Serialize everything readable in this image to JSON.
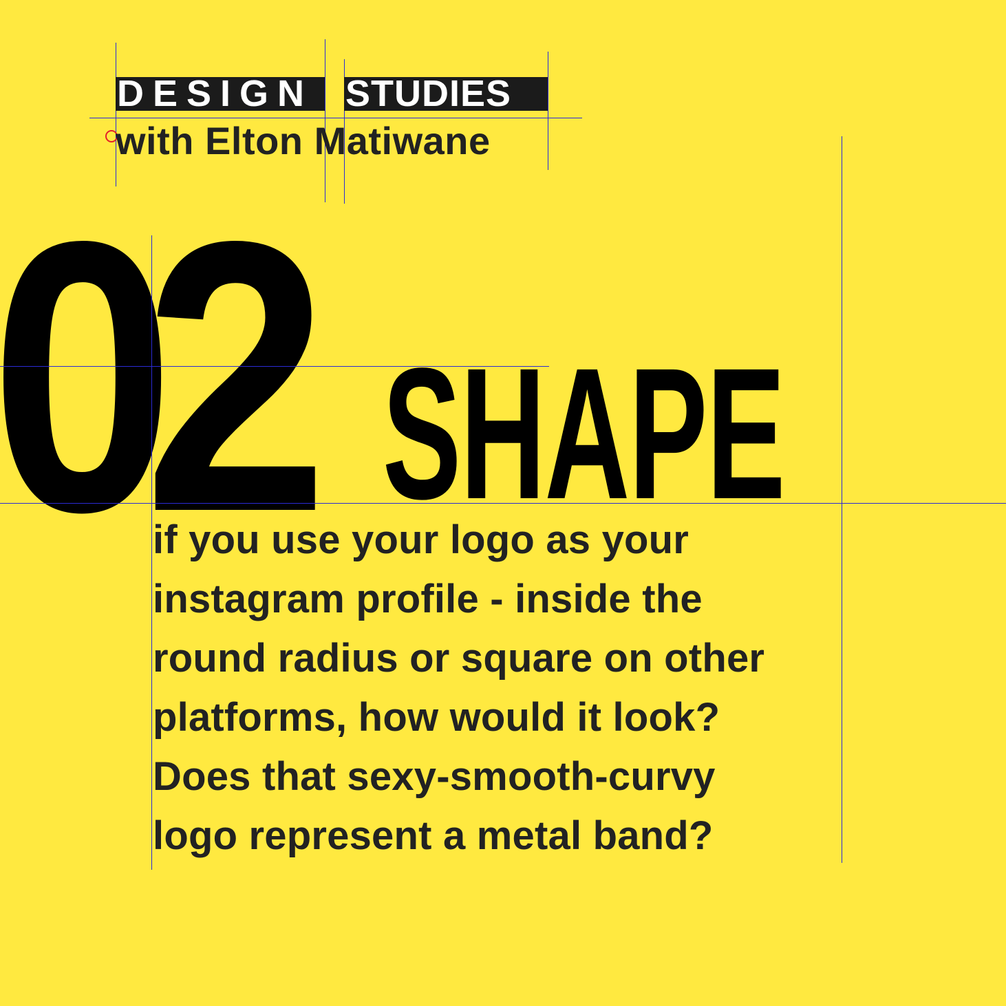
{
  "colors": {
    "background": "#FFE940",
    "title_bar": "#1B1B1B",
    "text_dark": "#222222",
    "display_black": "#000000",
    "guide_blue": "#2B2BD6",
    "anchor_red": "#E4202A"
  },
  "header": {
    "title_word_1": "DESIGN",
    "title_word_2": "STUDIES",
    "subtitle": "with Elton Matiwane"
  },
  "main": {
    "number": "02",
    "heading": "SHAPE",
    "body_lines": [
      "if you use your logo as your",
      "instagram profile - inside the",
      "round radius or square on other",
      "platforms, how would it look?",
      "Does that sexy-smooth-curvy",
      "logo represent a metal band?"
    ]
  }
}
